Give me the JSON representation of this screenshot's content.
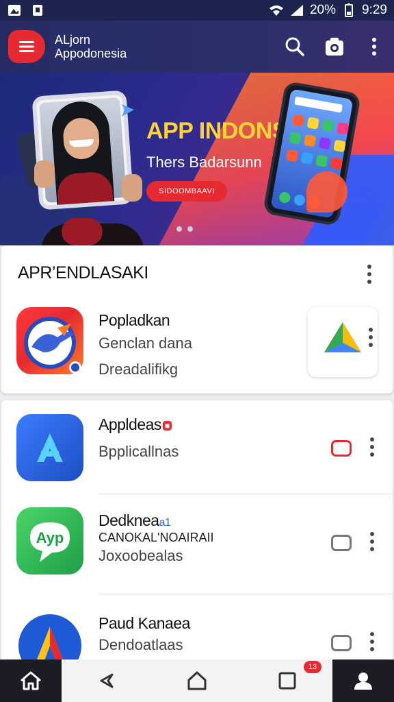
{
  "status_bar": {
    "battery": "20%",
    "time": "9:29",
    "left_icons": [
      "image-icon",
      "notification-icon"
    ],
    "right_icons": [
      "wifi-icon",
      "signal-icon",
      "battery-icon"
    ]
  },
  "app_bar": {
    "title_line1": "ALjorn",
    "title_line2": "Appodonesia",
    "icons": [
      "menu-icon",
      "search-icon",
      "camera-icon",
      "more-vert-icon"
    ]
  },
  "banner": {
    "title": "APP INDONSIA",
    "subtitle": "Thers Badarsunn",
    "button_label": "SIDOOMBAAVI",
    "carousel_position": 1,
    "carousel_count": 2
  },
  "section1": {
    "heading": "APR’ENDLASAKI",
    "featured": {
      "name": "Popladkan",
      "line1": "Genclan dana",
      "line2": "Dreadalifikg",
      "icon": "pelican-app-icon",
      "side_icon": "triangle-logo-icon"
    }
  },
  "section2": {
    "apps": [
      {
        "name": "Appldeas",
        "badge": "■",
        "subtitle": "Bpplicallnas",
        "icon": "blue-a-app-icon",
        "toggle_active": true
      },
      {
        "name": "Dedknea",
        "name_suffix": "a1",
        "caption": "CANOKAL'NOAIRAII",
        "subtitle": "Joxoobealas",
        "icon": "ayp-chat-app-icon",
        "toggle_active": false
      },
      {
        "name": "Paud Kanaea",
        "subtitle": "Dendoatlaas",
        "icon": "colorful-a-app-icon",
        "toggle_active": false
      }
    ]
  },
  "bottom_nav": {
    "items": [
      "home-icon",
      "back-icon",
      "house-outline-icon",
      "square-icon",
      "profile-icon"
    ],
    "badge": "13"
  },
  "colors": {
    "accent_red": "#e52a32",
    "app_bar": "#262c63",
    "banner_title": "#ffd43a"
  }
}
